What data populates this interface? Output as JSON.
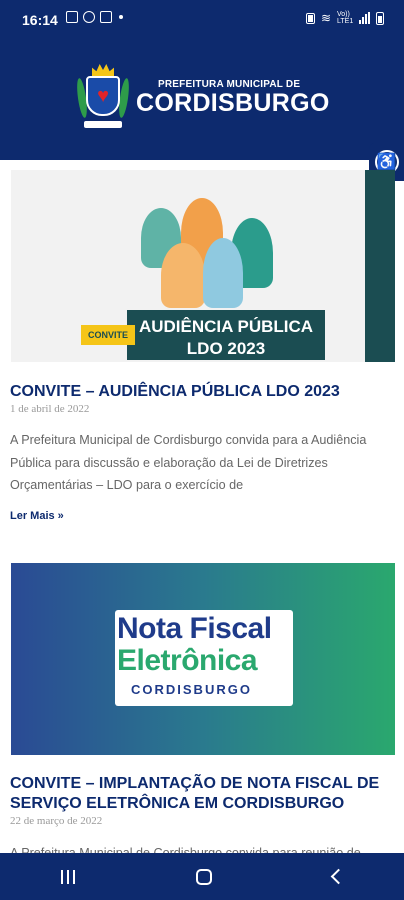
{
  "status_bar": {
    "time": "16:14",
    "network_label": "Vo)) LTE1"
  },
  "header": {
    "logo_line1": "PREFEITURA MUNICIPAL DE",
    "logo_line2": "CORDISBURGO"
  },
  "posts": [
    {
      "image_tag": "CONVITE",
      "image_banner": "AUDIÊNCIA PÚBLICA LDO 2023",
      "title": "CONVITE – AUDIÊNCIA PÚBLICA LDO 2023",
      "date": "1 de abril de 2022",
      "excerpt": "A Prefeitura Municipal de Cordisburgo convida para a Audiência Pública para discussão e elaboração da Lei de Diretrizes Orçamentárias – LDO para o exercício de",
      "read_more": "Ler Mais »"
    },
    {
      "image_line1": "Nota Fiscal",
      "image_line2": "Eletrônica",
      "image_line3": "CORDISBURGO",
      "title": "CONVITE – IMPLANTAÇÃO DE NOTA FISCAL DE SERVIÇO ELETRÔNICA EM CORDISBURGO",
      "date": "22 de março de 2022",
      "excerpt": "A Prefeitura Municipal de Cordisburgo convida para reunião de"
    }
  ],
  "colors": {
    "brand": "#0d2a6e",
    "accent_teal": "#1b4d52",
    "accent_yellow": "#f5c518",
    "green": "#2aa86e"
  }
}
